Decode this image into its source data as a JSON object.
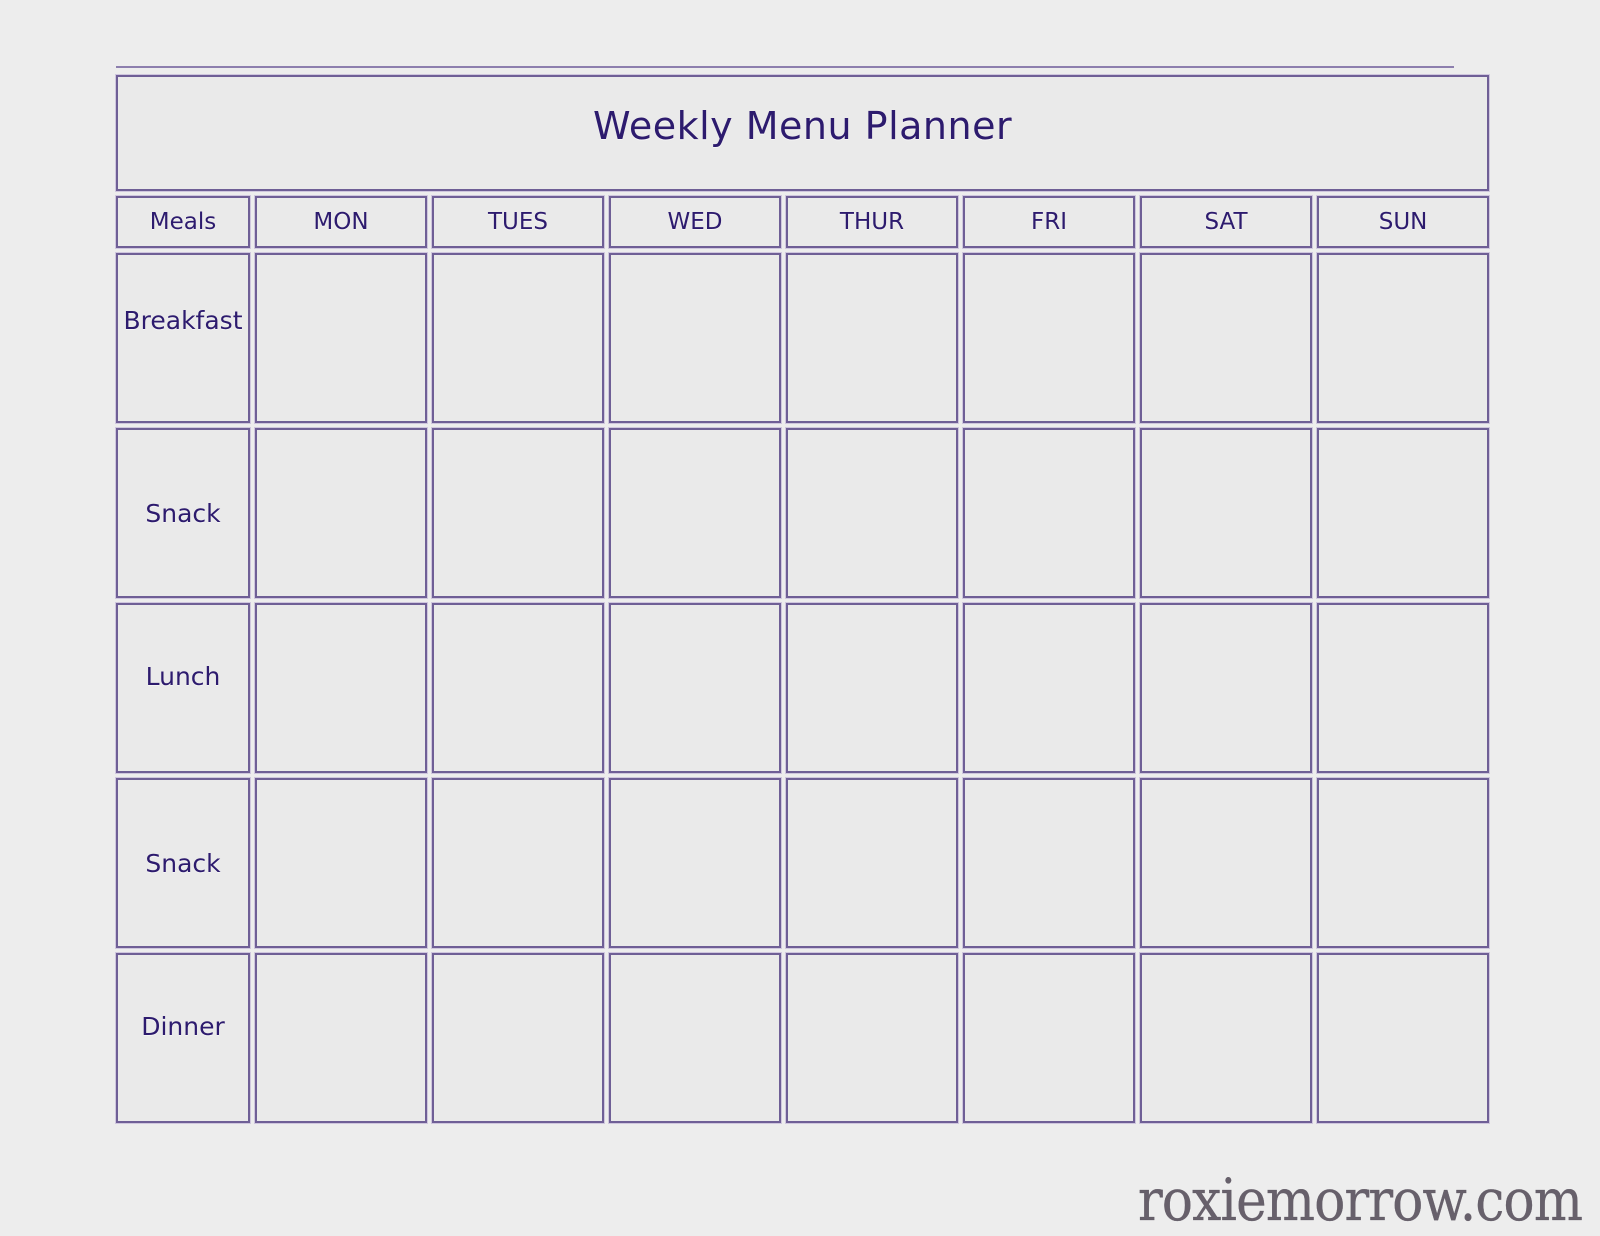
{
  "document": {
    "title": "Weekly Menu Planner",
    "watermark": "roxiemorrow.com"
  },
  "colors": {
    "page_background": "#ededed",
    "cell_background": "#eaeaea",
    "border": "#6f5f96",
    "text": "#2d1b6e",
    "watermark_text": "#5c5560"
  },
  "table": {
    "corner_header": "Meals",
    "day_headers": [
      "MON",
      "TUES",
      "WED",
      "THUR",
      "FRI",
      "SAT",
      "SUN"
    ],
    "meal_rows": [
      {
        "label": "Breakfast",
        "entries": [
          "",
          "",
          "",
          "",
          "",
          "",
          ""
        ]
      },
      {
        "label": "Snack",
        "entries": [
          "",
          "",
          "",
          "",
          "",
          "",
          ""
        ]
      },
      {
        "label": "Lunch",
        "entries": [
          "",
          "",
          "",
          "",
          "",
          "",
          ""
        ]
      },
      {
        "label": "Snack",
        "entries": [
          "",
          "",
          "",
          "",
          "",
          "",
          ""
        ]
      },
      {
        "label": "Dinner",
        "entries": [
          "",
          "",
          "",
          "",
          "",
          "",
          ""
        ]
      }
    ]
  }
}
